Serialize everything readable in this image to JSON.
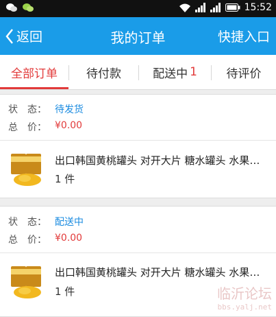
{
  "status_bar": {
    "time": "15:52"
  },
  "header": {
    "back_label": "返回",
    "title": "我的订单",
    "quick_entry": "快捷入口"
  },
  "tabs": [
    {
      "label": "全部订单",
      "badge": ""
    },
    {
      "label": "待付款",
      "badge": ""
    },
    {
      "label": "配送中",
      "badge": "1"
    },
    {
      "label": "待评价",
      "badge": ""
    }
  ],
  "orders": [
    {
      "status_label": "状　态：",
      "status": "待发货",
      "price_label": "总　价：",
      "price": "¥0.00",
      "product_name": "出口韩国黄桃罐头 对开大片 糖水罐头 水果罐头",
      "quantity": "1 件"
    },
    {
      "status_label": "状　态：",
      "status": "配送中",
      "price_label": "总　价：",
      "price": "¥0.00",
      "product_name": "出口韩国黄桃罐头 对开大片 糖水罐头 水果罐头",
      "quantity": "1 件"
    }
  ],
  "watermark": {
    "title": "临沂论坛",
    "url": "bbs.yalj.net"
  },
  "colors": {
    "header": "#1a9ce8",
    "active_tab": "#e23a3a",
    "status": "#1a8be0",
    "price": "#e23a3a"
  }
}
